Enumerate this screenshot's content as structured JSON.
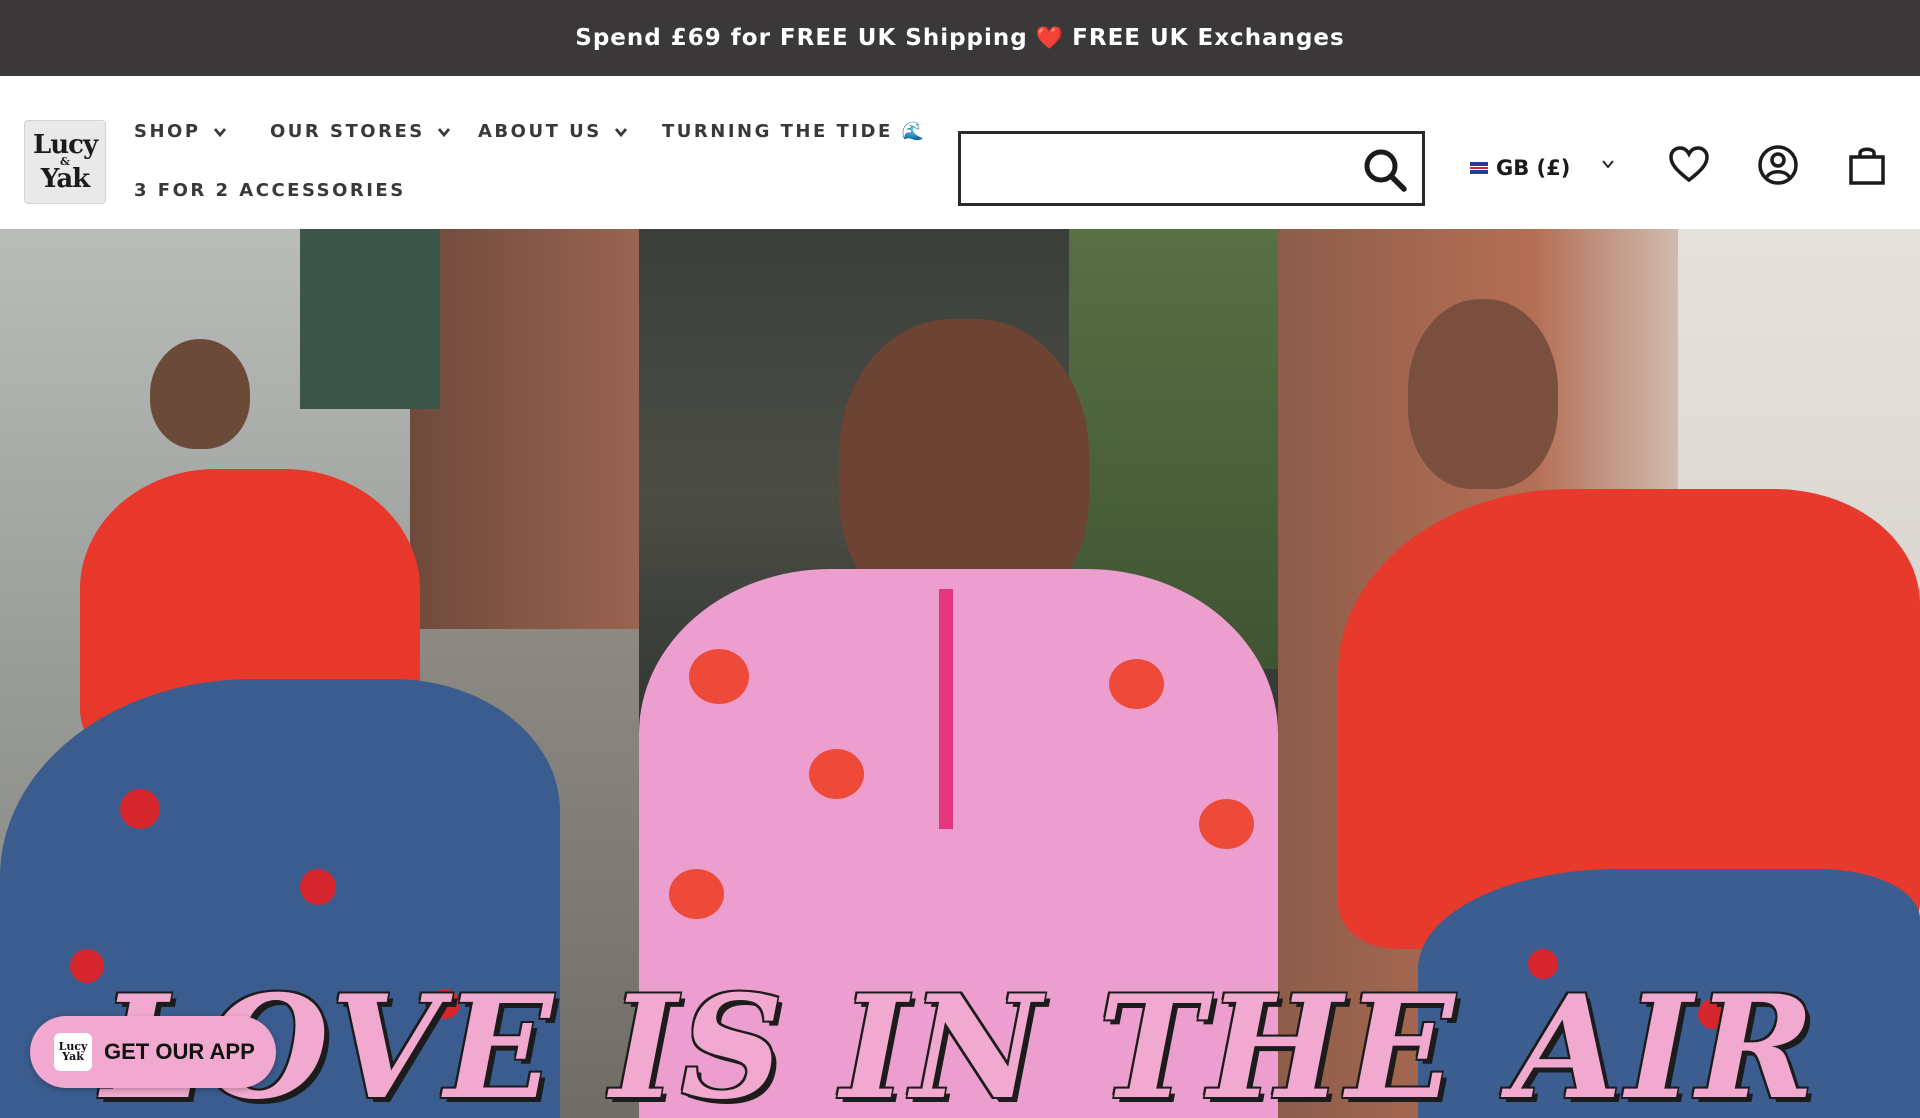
{
  "announcement": {
    "text_before": "Spend £69 for FREE UK Shipping",
    "heart": "❤️",
    "text_after": "FREE UK Exchanges"
  },
  "logo": {
    "line1": "Lucy",
    "line2": "&",
    "line3": "Yak"
  },
  "nav": {
    "items": [
      {
        "label": "SHOP",
        "has_dropdown": true
      },
      {
        "label": "OUR STORES",
        "has_dropdown": true
      },
      {
        "label": "ABOUT US",
        "has_dropdown": true
      },
      {
        "label": "TURNING THE TIDE 🌊",
        "has_dropdown": false
      },
      {
        "label": "3 FOR 2 ACCESSORIES",
        "has_dropdown": false
      }
    ]
  },
  "search": {
    "value": "",
    "placeholder": ""
  },
  "currency": {
    "label": "GB (£)"
  },
  "icons": {
    "search": "search-icon",
    "wishlist": "heart-icon",
    "account": "account-icon",
    "cart": "bag-icon"
  },
  "hero": {
    "title": "LOVE IS IN THE AIR"
  },
  "app_button": {
    "label": "GET OUR APP"
  },
  "colors": {
    "announce_bg": "#3a3839",
    "pink": "#f2a9cf",
    "red": "#e5232a"
  }
}
